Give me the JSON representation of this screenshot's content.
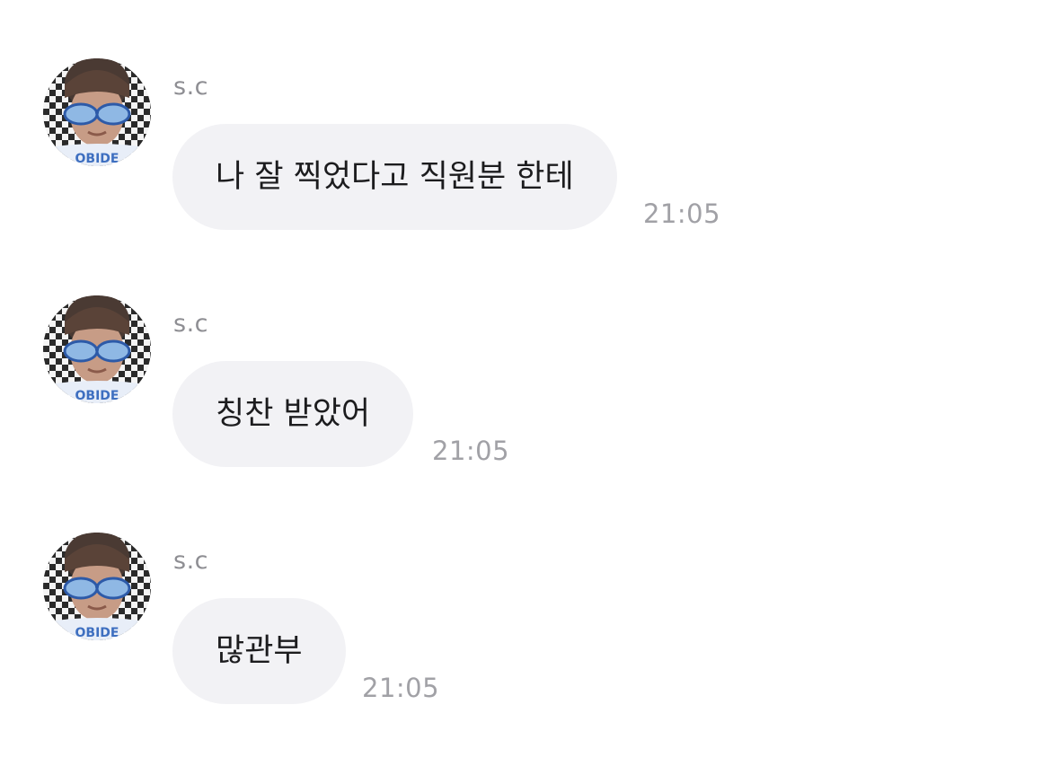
{
  "messages": [
    {
      "sender": "s.c",
      "text": "나 잘 찍었다고 직원분 한테",
      "time": "21:05"
    },
    {
      "sender": "s.c",
      "text": "칭찬 받았어",
      "time": "21:05"
    },
    {
      "sender": "s.c",
      "text": "많관부",
      "time": "21:05"
    }
  ],
  "colors": {
    "bubble_background": "#f2f2f5",
    "message_text": "#1c1c1e",
    "sender_name": "#8e8e93",
    "timestamp": "#a1a1a6",
    "page_background": "#ffffff"
  },
  "icons": {
    "avatar": "profile-photo-icon"
  }
}
